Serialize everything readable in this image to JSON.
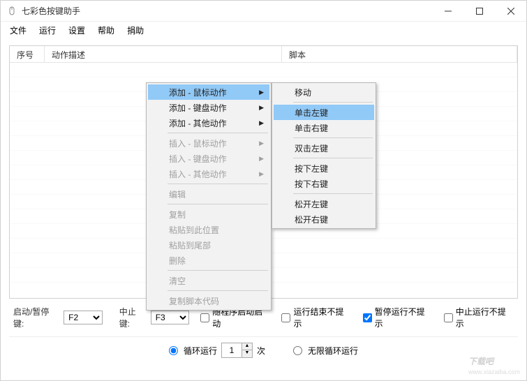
{
  "window": {
    "title": "七彩色按键助手"
  },
  "menubar": {
    "file": "文件",
    "run": "运行",
    "settings": "设置",
    "help": "帮助",
    "donate": "捐助"
  },
  "table": {
    "headers": {
      "seq": "序号",
      "desc": "动作描述",
      "script": "脚本"
    }
  },
  "context_menu": {
    "add_mouse": "添加 - 鼠标动作",
    "add_keyboard": "添加 - 键盘动作",
    "add_other": "添加 - 其他动作",
    "insert_mouse": "插入 - 鼠标动作",
    "insert_keyboard": "插入 - 键盘动作",
    "insert_other": "插入 - 其他动作",
    "edit": "编辑",
    "copy": "复制",
    "paste_here": "粘贴到此位置",
    "paste_end": "粘贴到尾部",
    "delete": "删除",
    "clear": "清空",
    "copy_code": "复制脚本代码"
  },
  "submenu": {
    "move": "移动",
    "click_left": "单击左键",
    "click_right": "单击右键",
    "dblclick_left": "双击左键",
    "press_left": "按下左键",
    "press_right": "按下右键",
    "release_left": "松开左键",
    "release_right": "松开右键"
  },
  "bottom": {
    "start_stop_label": "启动/暂停键:",
    "start_stop_key": "F2",
    "abort_label": "中止键:",
    "abort_key": "F3",
    "chk_autostart_label": "随程序启动启动",
    "chk_autostart": false,
    "chk_end_noprompt_label": "运行结束不提示",
    "chk_end_noprompt": false,
    "chk_pause_noprompt_label": "暂停运行不提示",
    "chk_pause_noprompt": true,
    "chk_abort_noprompt_label": "中止运行不提示",
    "chk_abort_noprompt": false,
    "loop_run_label": "循环运行",
    "loop_count": "1",
    "loop_times_suffix": "次",
    "loop_infinite_label": "无限循环运行",
    "loop_mode": "count"
  },
  "watermark": {
    "text": "下载吧",
    "url": "www.xiazaiba.com"
  }
}
